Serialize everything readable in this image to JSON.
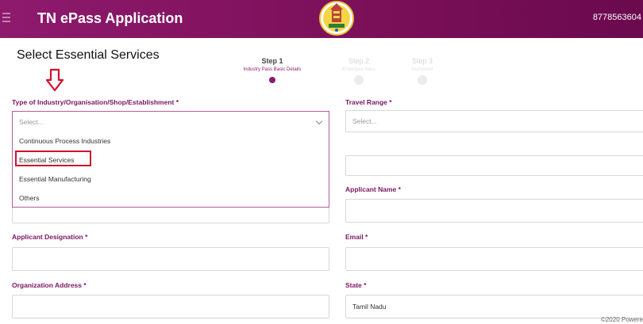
{
  "header": {
    "title": "TN ePass Application",
    "phone": "8778563604",
    "colors": {
      "brand": "#8e1a6d",
      "highlight": "#d0122a"
    }
  },
  "overlay": {
    "heading": "Select Essential Services"
  },
  "steps": [
    {
      "title": "Step 1",
      "subtitle": "Industry Pass Basic Details",
      "active": true
    },
    {
      "title": "Step 2",
      "subtitle": "Employee Pass",
      "active": false
    },
    {
      "title": "Step 3",
      "subtitle": "Document",
      "active": false
    }
  ],
  "form": {
    "industry_type": {
      "label": "Type of Industry/Organisation/Shop/Establishment *",
      "placeholder": "Select...",
      "options": [
        "Continuous Process Industries",
        "Essential Services",
        "Essential Manufacturing",
        "Others"
      ],
      "highlighted_option": "Essential Services"
    },
    "travel_range": {
      "label": "Travel Range *",
      "placeholder": "Select..."
    },
    "applicant_name": {
      "label": "Applicant Name *"
    },
    "applicant_designation": {
      "label": "Applicant Designation *"
    },
    "email": {
      "label": "Email *"
    },
    "organization_address": {
      "label": "Organization Address *"
    },
    "state": {
      "label": "State *",
      "value": "Tamil Nadu"
    }
  },
  "footer": {
    "text": "©2020 Powere"
  }
}
